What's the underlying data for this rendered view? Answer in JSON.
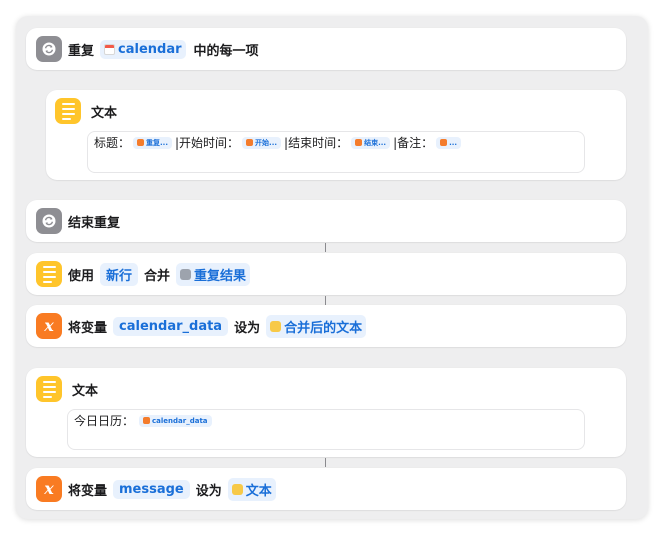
{
  "actions": {
    "repeat_each": {
      "label_prefix": "重复",
      "variable": "calendar",
      "label_suffix": "中的每一项",
      "icon": "repeat-icon",
      "variable_icon": "calendar-icon"
    },
    "text1": {
      "label": "文本",
      "icon": "text-lines-icon",
      "content": {
        "title_label": "标题：",
        "title_token": "重复...",
        "start_label": "|开始时间：",
        "start_token": "开始...",
        "end_label": "|结束时间：",
        "end_token": "结束...",
        "note_label": "|备注：",
        "note_token": "..."
      }
    },
    "end_repeat": {
      "label": "结束重复",
      "icon": "repeat-icon"
    },
    "combine": {
      "label_use": "使用",
      "separator": "新行",
      "label_combine": "合并",
      "input": "重复结果",
      "icon": "text-lines-icon"
    },
    "set_var1": {
      "label_prefix": "将变量",
      "name": "calendar_data",
      "label_set": "设为",
      "value": "合并后的文本",
      "icon": "variable-x-icon"
    },
    "text2": {
      "label": "文本",
      "icon": "text-lines-icon",
      "content": {
        "prefix": "今日日历：",
        "token": "calendar_data"
      }
    },
    "set_var2": {
      "label_prefix": "将变量",
      "name": "message",
      "label_set": "设为",
      "value": "文本",
      "icon": "variable-x-icon"
    }
  },
  "colors": {
    "panel_bg": "#eeeeef",
    "token_bg": "#e8f1fd",
    "token_text": "#1a6fd8",
    "gray_icon": "#8e8e93",
    "yellow_icon": "#ffc52b",
    "orange_icon": "#f97b22"
  }
}
